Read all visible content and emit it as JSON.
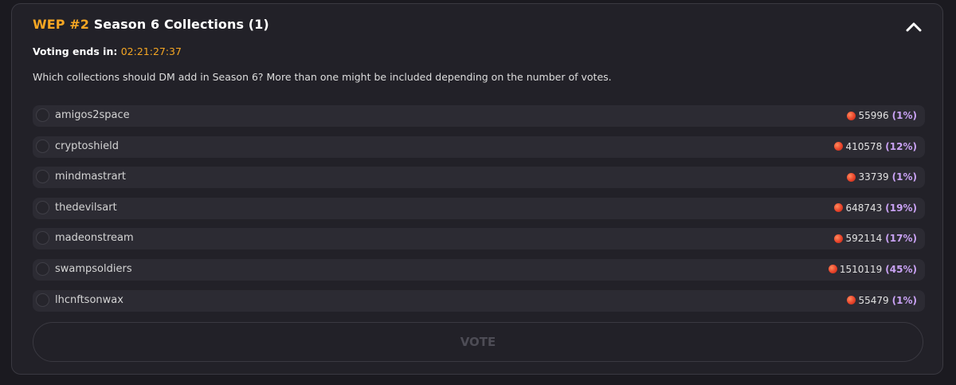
{
  "header": {
    "code": "WEP #2",
    "title": "Season 6 Collections (1)"
  },
  "voting": {
    "label": "Voting ends in:",
    "time": "02:21:27:37"
  },
  "question": "Which collections should DM add in Season 6? More than one might be included depending on the number of votes.",
  "options": [
    {
      "label": "amigos2space",
      "votes": "55996",
      "pct": "(1%)"
    },
    {
      "label": "cryptoshield",
      "votes": "410578",
      "pct": "(12%)"
    },
    {
      "label": "mindmastrart",
      "votes": "33739",
      "pct": "(1%)"
    },
    {
      "label": "thedevilsart",
      "votes": "648743",
      "pct": "(19%)"
    },
    {
      "label": "madeonstream",
      "votes": "592114",
      "pct": "(17%)"
    },
    {
      "label": "swampsoldiers",
      "votes": "1510119",
      "pct": "(45%)"
    },
    {
      "label": "lhcnftsonwax",
      "votes": "55479",
      "pct": "(1%)"
    }
  ],
  "vote_button": "VOTE",
  "icons": {
    "collapse": "chevron-up-icon",
    "token": "token-coin-icon",
    "radio": "radio-unchecked-icon"
  },
  "colors": {
    "accent": "#f5a623",
    "percent": "#c9a2f4",
    "token": "#e8432a"
  }
}
